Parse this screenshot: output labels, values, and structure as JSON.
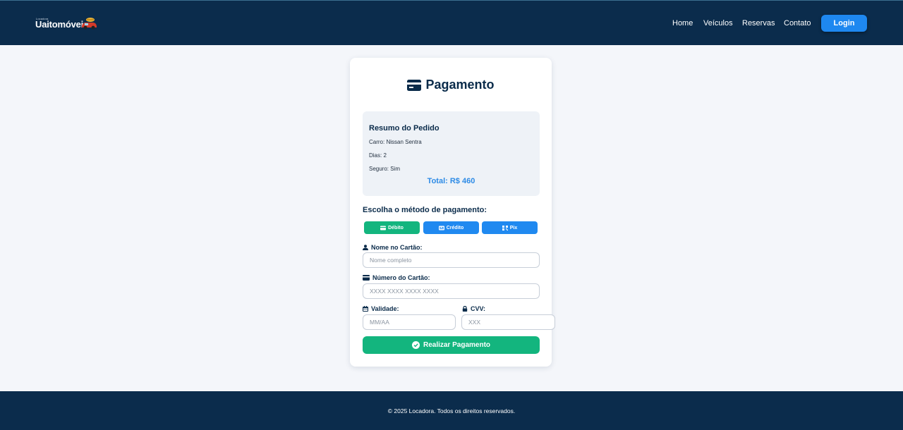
{
  "header": {
    "logo_small": "Locadora",
    "logo_main": "Uaitomóveis",
    "nav": [
      "Home",
      "Veículos",
      "Reservas",
      "Contato"
    ],
    "login_label": "Login"
  },
  "card": {
    "title": "Pagamento",
    "summary": {
      "title": "Resumo do Pedido",
      "car": "Carro: Nissan Sentra",
      "days": "Dias: 2",
      "insurance": "Seguro: Sim",
      "total": "Total: R$ 460"
    },
    "method_label": "Escolha o método de pagamento:",
    "methods": [
      {
        "label": "Débito",
        "color": "#13b57e"
      },
      {
        "label": "Crédito",
        "color": "#2089f0"
      },
      {
        "label": "Pix",
        "color": "#2089f0"
      }
    ],
    "fields": {
      "name_label": "Nome no Cartão:",
      "name_placeholder": "Nome completo",
      "number_label": "Número do Cartão:",
      "number_placeholder": "XXXX XXXX XXXX XXXX",
      "expiry_label": "Validade:",
      "expiry_placeholder": "MM/AA",
      "cvv_label": "CVV:",
      "cvv_placeholder": "XXX"
    },
    "submit_label": "Realizar Pagamento"
  },
  "footer": {
    "text": "© 2025 Locadora. Todos os direitos reservados."
  },
  "colors": {
    "navy": "#0b2c4c",
    "accent_blue": "#1e88f0",
    "accent_green": "#13b57e",
    "page_bg": "#f4f6fa"
  }
}
